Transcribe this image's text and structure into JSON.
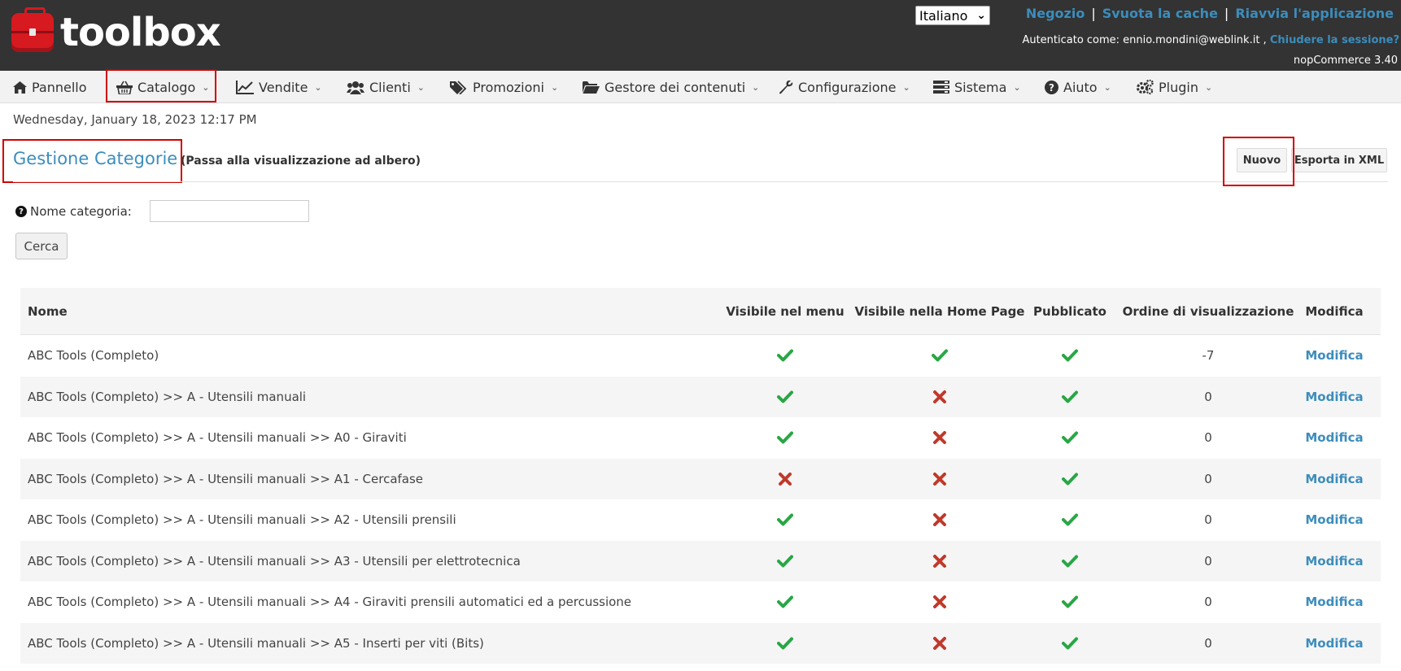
{
  "header": {
    "logo_text": "toolbox",
    "language": "Italiano",
    "links": [
      "Negozio",
      "Svuota la cache",
      "Riavvia l'applicazione"
    ],
    "separator": "|",
    "auth_prefix": "Autenticato come: ennio.mondini@weblink.it ,",
    "logout_label": "Chiudere la sessione?",
    "version": "nopCommerce 3.40"
  },
  "menu": [
    {
      "label": "Pannello",
      "icon": "home-icon"
    },
    {
      "label": "Catalogo",
      "icon": "basket-icon"
    },
    {
      "label": "Vendite",
      "icon": "chart-line-icon"
    },
    {
      "label": "Clienti",
      "icon": "users-icon"
    },
    {
      "label": "Promozioni",
      "icon": "tags-icon"
    },
    {
      "label": "Gestore dei contenuti",
      "icon": "folder-open-icon"
    },
    {
      "label": "Configurazione",
      "icon": "wrench-icon"
    },
    {
      "label": "Sistema",
      "icon": "server-icon"
    },
    {
      "label": "Aiuto",
      "icon": "question-circle-icon"
    },
    {
      "label": "Plugin",
      "icon": "cogs-icon"
    }
  ],
  "date_time": "Wednesday, January 18, 2023 12:17 PM",
  "page": {
    "title": "Gestione Categorie",
    "tree_view_link": "(Passa alla visualizzazione ad albero)",
    "new_button": "Nuovo",
    "export_button": "Esporta in XML"
  },
  "search": {
    "label": "Nome categoria:",
    "value": "",
    "button": "Cerca"
  },
  "table": {
    "columns": [
      "Nome",
      "Visibile nel menu",
      "Visibile nella Home Page",
      "Pubblicato",
      "Ordine di visualizzazione",
      "Modifica"
    ],
    "edit_label": "Modifica",
    "rows": [
      {
        "name": "ABC Tools (Completo)",
        "menu": true,
        "home": true,
        "published": true,
        "order": "-7"
      },
      {
        "name": "ABC Tools (Completo) >> A - Utensili manuali",
        "menu": true,
        "home": false,
        "published": true,
        "order": "0"
      },
      {
        "name": "ABC Tools (Completo) >> A - Utensili manuali >> A0 - Giraviti",
        "menu": true,
        "home": false,
        "published": true,
        "order": "0"
      },
      {
        "name": "ABC Tools (Completo) >> A - Utensili manuali >> A1 - Cercafase",
        "menu": false,
        "home": false,
        "published": true,
        "order": "0"
      },
      {
        "name": "ABC Tools (Completo) >> A - Utensili manuali >> A2 - Utensili prensili",
        "menu": true,
        "home": false,
        "published": true,
        "order": "0"
      },
      {
        "name": "ABC Tools (Completo) >> A - Utensili manuali >> A3 - Utensili per elettrotecnica",
        "menu": true,
        "home": false,
        "published": true,
        "order": "0"
      },
      {
        "name": "ABC Tools (Completo) >> A - Utensili manuali >> A4 - Giraviti prensili automatici ed a percussione",
        "menu": true,
        "home": false,
        "published": true,
        "order": "0"
      },
      {
        "name": "ABC Tools (Completo) >> A - Utensili manuali >> A5 - Inserti per viti (Bits)",
        "menu": true,
        "home": false,
        "published": true,
        "order": "0"
      }
    ]
  },
  "colors": {
    "header_bg": "#333333",
    "accent": "#3c8dbc",
    "check": "#28a745",
    "cross": "#c0392b",
    "highlight": "#d00000"
  }
}
